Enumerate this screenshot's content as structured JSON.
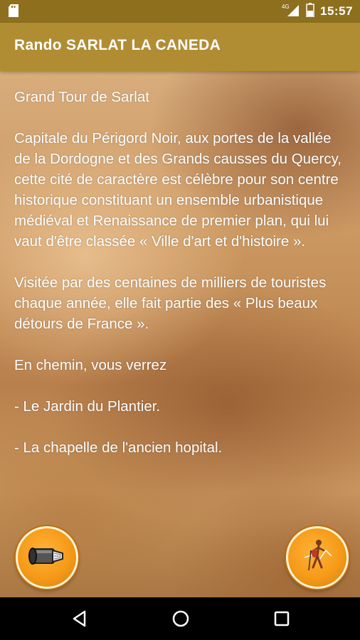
{
  "status_bar": {
    "time": "15:57",
    "network": "4G"
  },
  "app_bar": {
    "title": "Rando SARLAT LA CANEDA"
  },
  "content": {
    "heading": "Grand Tour de Sarlat",
    "paragraphs": [
      "Capitale du Périgord Noir, aux portes de la vallée de la Dordogne et des Grands causses du Quercy, cette cité de caractère est célèbre pour son centre historique constituant un ensemble urbanistique médiéval et Renaissance de premier plan, qui lui vaut d'être classée « Ville d'art et d'histoire ».",
      "Visitée par des centaines de milliers de touristes chaque année, elle fait partie des « Plus beaux détours de France ».",
      "En chemin, vous verrez",
      "- Le Jardin du Plantier.",
      "- La chapelle de l'ancien hopital."
    ]
  },
  "buttons": {
    "left_icon": "scroll-icon",
    "right_icon": "hiker-icon"
  },
  "nav": {
    "back_icon": "back-triangle-icon",
    "home_icon": "home-circle-icon",
    "recent_icon": "recent-square-icon"
  }
}
